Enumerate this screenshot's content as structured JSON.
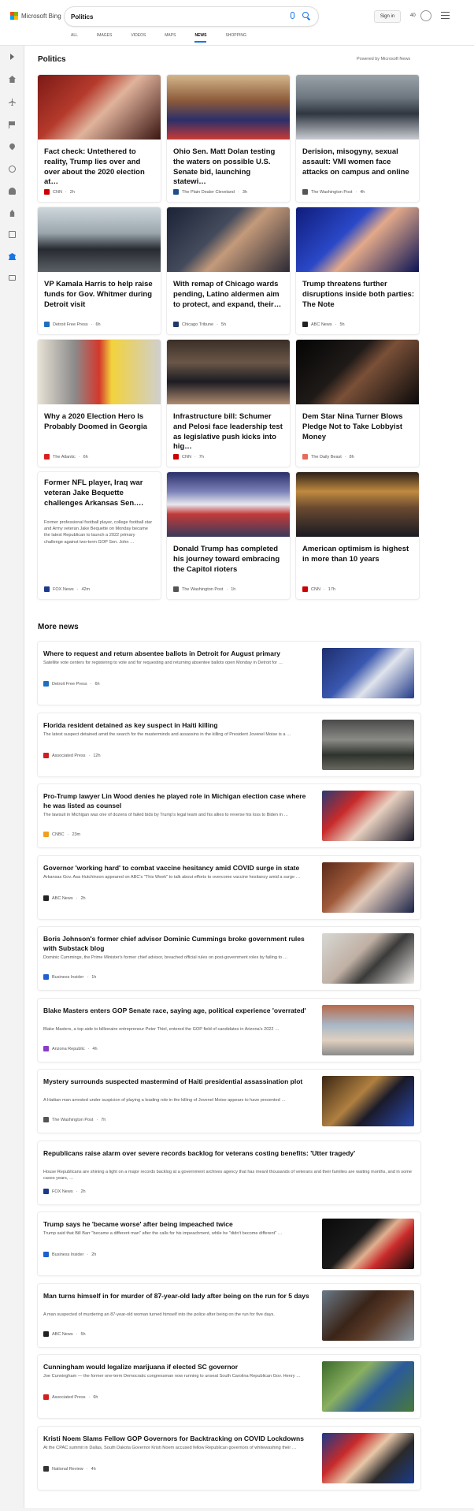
{
  "header": {
    "brand": "Microsoft Bing",
    "search_value": "Politics",
    "signin_label": "Sign in",
    "rewards_count": "40",
    "tabs": [
      {
        "label": "ALL"
      },
      {
        "label": "IMAGES"
      },
      {
        "label": "VIDEOS"
      },
      {
        "label": "MAPS"
      },
      {
        "label": "NEWS"
      },
      {
        "label": "SHOPPING"
      }
    ]
  },
  "sidebar": {
    "icons": [
      "chevron-right-icon",
      "home-icon",
      "tools-icon",
      "flag-icon",
      "location-pin-icon",
      "globe-icon",
      "person-icon",
      "rocket-icon",
      "card-icon",
      "bank-icon",
      "payment-icon"
    ]
  },
  "politics": {
    "title": "Politics",
    "powered_by": "Powered by Microsoft News",
    "cards": [
      {
        "title": "Fact check: Untethered to reality, Trump lies over and over about the 2020 election at…",
        "source": "CNN",
        "age": "2h",
        "favicon": "#cc0000",
        "img": "linear-gradient(135deg,#7b1a16 0%,#b53a2c 35%,#e0b39b 55%,#3a1512 100%)"
      },
      {
        "title": "Ohio Sen. Matt Dolan testing the waters on possible U.S. Senate bid, launching statewi…",
        "source": "The Plain Dealer Cleveland",
        "age": "3h",
        "favicon": "#1f4e8c",
        "img": "linear-gradient(180deg,#d4b68a 0%,#8c5a3a 40%,#2b2f6a 70%,#c93a34 100%)"
      },
      {
        "title": "Derision, misogyny, sexual assault: VMI women face attacks on campus and online",
        "source": "The Washington Post",
        "age": "4h",
        "favicon": "#555555",
        "img": "linear-gradient(180deg,#9aa3a8 0%,#6e7780 35%,#2f3640 60%,#c9ccd2 100%)"
      },
      {
        "title": "VP Kamala Harris to help raise funds for Gov. Whitmer during Detroit visit",
        "source": "Detroit Free Press",
        "age": "6h",
        "favicon": "#1f6fbf",
        "img": "linear-gradient(180deg,#cfd7dc 0%,#9aa6ac 40%,#272a31 65%,#5b6166 100%)"
      },
      {
        "title": "With remap of Chicago wards pending, Latino aldermen aim to protect, and expand, their…",
        "source": "Chicago Tribune",
        "age": "5h",
        "favicon": "#1f3a6b",
        "img": "linear-gradient(135deg,#1c2237 0%,#444b5c 40%,#c49a7a 55%,#2c2a35 100%)"
      },
      {
        "title": "Trump threatens further disruptions inside both parties: The Note",
        "source": "ABC News",
        "age": "5h",
        "favicon": "#222222",
        "img": "linear-gradient(135deg,#101c7a 0%,#2a48c8 40%,#e3a98a 55%,#0b1454 100%)"
      },
      {
        "title": "Why a 2020 Election Hero Is Probably Doomed in Georgia",
        "source": "The Atlantic",
        "age": "6h",
        "favicon": "#d92020",
        "img": "linear-gradient(90deg,#e8e2d6 0%,#8b8b8b 30%,#d4382c 50%,#f2d23b 60%,#cfcfcf 100%)"
      },
      {
        "title": "Infrastructure bill: Schumer and Pelosi face leadership test as legislative push kicks into hig…",
        "source": "CNN",
        "age": "7h",
        "favicon": "#cc0000",
        "img": "linear-gradient(180deg,#3a2e26 0%,#6a5648 35%,#1c1c22 65%,#b08c70 100%)"
      },
      {
        "title": "Dem Star Nina Turner Blows Pledge Not to Take Lobbyist Money",
        "source": "The Daily Beast",
        "age": "8h",
        "favicon": "#e86a5a",
        "img": "linear-gradient(135deg,#050505 0%,#1e1a18 40%,#7a5038 55%,#0a0a0a 100%)"
      },
      {
        "title": "Former NFL player, Iraq war veteran Jake Bequette challenges Arkansas Sen.…",
        "snippet": "Former professional football player, college football star and Army veteran Jake Bequette on Monday became the latest Republican to launch a 2022 primary challenge against two-term GOP Sen. John …",
        "source": "FOX News",
        "age": "42m",
        "favicon": "#1a3a8a"
      },
      {
        "title": "Donald Trump has completed his journey toward embracing the Capitol rioters",
        "source": "The Washington Post",
        "age": "1h",
        "favicon": "#555555",
        "img": "linear-gradient(180deg,#2a2f6a 0%,#7c82b8 30%,#e8e8ee 50%,#c23a3a 65%,#3a3a5a 100%)"
      },
      {
        "title": "American optimism is highest in more than 10 years",
        "source": "CNN",
        "age": "17h",
        "favicon": "#cc0000",
        "img": "linear-gradient(180deg,#2c2018 0%,#c08a40 30%,#6a4a30 55%,#1a1a22 100%)"
      }
    ]
  },
  "more_news": {
    "title": "More news",
    "items": [
      {
        "title": "Where to request and return absentee ballots in Detroit for August primary",
        "snippet": "Satellite vote centers for registering to vote and for requesting and returning absentee ballots open Monday in Detroit for …",
        "source": "Detroit Free Press",
        "age": "6h",
        "favicon": "#1f6fbf",
        "img": "linear-gradient(135deg,#1d2e6e 0%,#3a58b0 40%,#e0e4ec 60%,#223a88 100%)"
      },
      {
        "title": "Florida resident detained as key suspect in Haiti killing",
        "snippet": "The latest suspect detained amid the search for the masterminds and assassins in the killing of President Jovenel Moise is a …",
        "source": "Associated Press",
        "age": "12h",
        "favicon": "#d11f1f",
        "img": "linear-gradient(180deg,#4a4a4a 0%,#8a8a86 40%,#2f332e 70%,#6a6a60 100%)"
      },
      {
        "title": "Pro-Trump lawyer Lin Wood denies he played role in Michigan election case where he was listed as counsel",
        "snippet": "The lawsuit in Michigan was one of dozens of failed bids by Trump's legal team and his allies to reverse his loss to Biden in …",
        "source": "CNBC",
        "age": "23m",
        "favicon": "#f0a020",
        "img": "linear-gradient(135deg,#2a3a70 0%,#c82a2a 30%,#e8d0c0 55%,#1a1a2a 100%)"
      },
      {
        "title": "Governor 'working hard' to combat vaccine hesitancy amid COVID surge in state",
        "snippet": "Arkansas Gov. Asa Hutchinson appeared on ABC's \"This Week\" to talk about efforts to overcome vaccine hesitancy amid a surge …",
        "source": "ABC News",
        "age": "2h",
        "favicon": "#222222",
        "img": "linear-gradient(135deg,#5a2a1a 0%,#a05a3a 35%,#e0c8b8 55%,#1a2448 100%)"
      },
      {
        "title": "Boris Johnson's former chief advisor Dominic Cummings broke government rules with Substack blog",
        "snippet": "Dominic Cummings, the Prime Minister's former chief advisor, breached official rules on post-government roles by failing to …",
        "source": "Business Insider",
        "age": "1h",
        "favicon": "#1f5fd0",
        "img": "linear-gradient(135deg,#d8d8d4 0%,#c0b0a4 40%,#3a3a3a 60%,#e8e4e0 100%)"
      },
      {
        "title": "Blake Masters enters GOP Senate race, saying age, political experience 'overrated'",
        "snippet": "Blake Masters, a top aide to billionaire entrepreneur Peter Thiel, entered the GOP field of candidates in Arizona's 2022 …",
        "source": "Arizona Republic",
        "age": "4h",
        "favicon": "#8a3cc8",
        "img": "linear-gradient(180deg,#b86a4a 0%,#a8b8c8 40%,#e0d0c0 70%,#8a8a8a 100%)"
      },
      {
        "title": "Mystery surrounds suspected mastermind of Haiti presidential assassination plot",
        "snippet": "A Haitian man arrested under suspicion of playing a leading role in the killing of Jovenel Moise appears to have presented …",
        "source": "The Washington Post",
        "age": "7h",
        "favicon": "#555555",
        "img": "linear-gradient(135deg,#3a2614 0%,#b08040 40%,#1a1a2a 60%,#2a4ab0 100%)"
      },
      {
        "title": "Republicans raise alarm over severe records backlog for veterans costing benefits: 'Utter tragedy'",
        "snippet": "House Republicans are shining a light on a major records backlog at a government archives agency that has meant thousands of veterans and their families are waiting months, and in some cases years, …",
        "source": "FOX News",
        "age": "2h",
        "favicon": "#1a3a8a"
      },
      {
        "title": "Trump says he 'became worse' after being impeached twice",
        "snippet": "Trump said that Bill Barr \"became a different man\" after the calls for his impeachment, while he \"didn't become different\" …",
        "source": "Business Insider",
        "age": "2h",
        "favicon": "#1f5fd0",
        "img": "linear-gradient(135deg,#0a0a0a 0%,#1a1a1a 40%,#e0b090 55%,#c82a2a 70%,#0a0a0a 100%)"
      },
      {
        "title": "Man turns himself in for murder of 87-year-old lady after being on the run for 5 days",
        "snippet": "A man suspected of murdering an 87-year-old woman turned himself into the police after being on the run for five days.",
        "source": "ABC News",
        "age": "5h",
        "favicon": "#222222",
        "img": "linear-gradient(135deg,#6a7a88 0%,#3a2418 40%,#5a3a28 60%,#8a96a0 100%)"
      },
      {
        "title": "Cunningham would legalize marijuana if elected SC governor",
        "snippet": "Joe Cunningham — the former one-term Democratic congressman now running to unseat South Carolina Republican Gov. Henry …",
        "source": "Associated Press",
        "age": "6h",
        "favicon": "#d11f1f",
        "img": "linear-gradient(135deg,#3a6a2a 0%,#8ab060 35%,#2a5a9a 60%,#4a7a3a 100%)"
      },
      {
        "title": "Kristi Noem Slams Fellow GOP Governors for Backtracking on COVID Lockdowns",
        "snippet": "At the CPAC summit in Dallas, South Dakota Governor Kristi Noem accused fellow Republican governors of whitewashing their …",
        "source": "National Review",
        "age": "4h",
        "favicon": "#333333",
        "img": "linear-gradient(135deg,#1a3a8a 0%,#c82a2a 30%,#e8c8a8 50%,#2a2a2a 70%,#1a3a8a 100%)"
      }
    ]
  }
}
